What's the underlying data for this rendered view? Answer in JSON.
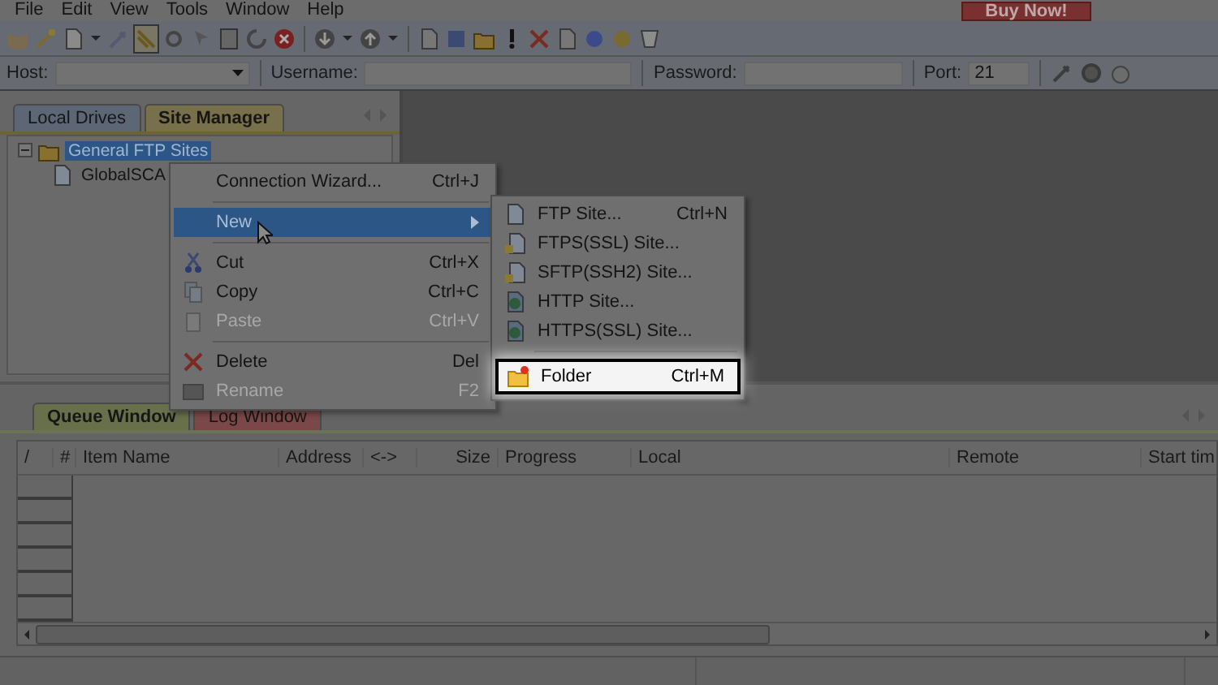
{
  "menu_bar": [
    {
      "label": "File"
    },
    {
      "label": "Edit"
    },
    {
      "label": "View"
    },
    {
      "label": "Tools"
    },
    {
      "label": "Window"
    },
    {
      "label": "Help"
    }
  ],
  "buy_button": "Buy Now!",
  "connection_bar": {
    "host_label": "Host:",
    "username_label": "Username:",
    "password_label": "Password:",
    "port_label": "Port:",
    "port_value": "21"
  },
  "left_tabs": [
    {
      "label": "Local Drives",
      "selected": false
    },
    {
      "label": "Site Manager",
      "selected": true
    }
  ],
  "tree": [
    {
      "label": "General FTP Sites",
      "selected": true,
      "expanded": true,
      "children": [
        {
          "label": "GlobalSCA",
          "selected": false
        }
      ]
    }
  ],
  "context_menu": [
    {
      "kind": "item",
      "label": "Connection Wizard...",
      "shortcut": "Ctrl+J",
      "disabled": false,
      "selected": false
    },
    {
      "kind": "separator"
    },
    {
      "kind": "submenu",
      "label": "New",
      "disabled": false,
      "selected": true
    },
    {
      "kind": "separator"
    },
    {
      "kind": "item",
      "label": "Cut",
      "shortcut": "Ctrl+X",
      "disabled": false,
      "selected": false
    },
    {
      "kind": "item",
      "label": "Copy",
      "shortcut": "Ctrl+C",
      "disabled": false,
      "selected": false
    },
    {
      "kind": "item",
      "label": "Paste",
      "shortcut": "Ctrl+V",
      "disabled": true,
      "selected": false
    },
    {
      "kind": "separator"
    },
    {
      "kind": "item",
      "label": "Delete",
      "shortcut": "Del",
      "disabled": false,
      "selected": false
    },
    {
      "kind": "item",
      "label": "Rename",
      "shortcut": "F2",
      "disabled": true,
      "selected": false
    }
  ],
  "new_submenu": [
    {
      "kind": "item",
      "label": "FTP Site...",
      "shortcut": "Ctrl+N",
      "selected": false
    },
    {
      "kind": "item",
      "label": "FTPS(SSL) Site...",
      "selected": false
    },
    {
      "kind": "item",
      "label": "SFTP(SSH2) Site...",
      "selected": false
    },
    {
      "kind": "item",
      "label": "HTTP Site...",
      "selected": false
    },
    {
      "kind": "item",
      "label": "HTTPS(SSL) Site...",
      "selected": false
    },
    {
      "kind": "separator"
    },
    {
      "kind": "item",
      "label": "Folder",
      "shortcut": "Ctrl+M",
      "selected": true
    }
  ],
  "bottom_tabs": [
    {
      "label": "Queue Window",
      "selected": true
    },
    {
      "label": "Log Window",
      "selected": false
    }
  ],
  "queue_columns": [
    "/",
    "#",
    "Item Name",
    "Address",
    "<->",
    "Size",
    "Progress",
    "Local",
    "Remote",
    "Start tim"
  ]
}
